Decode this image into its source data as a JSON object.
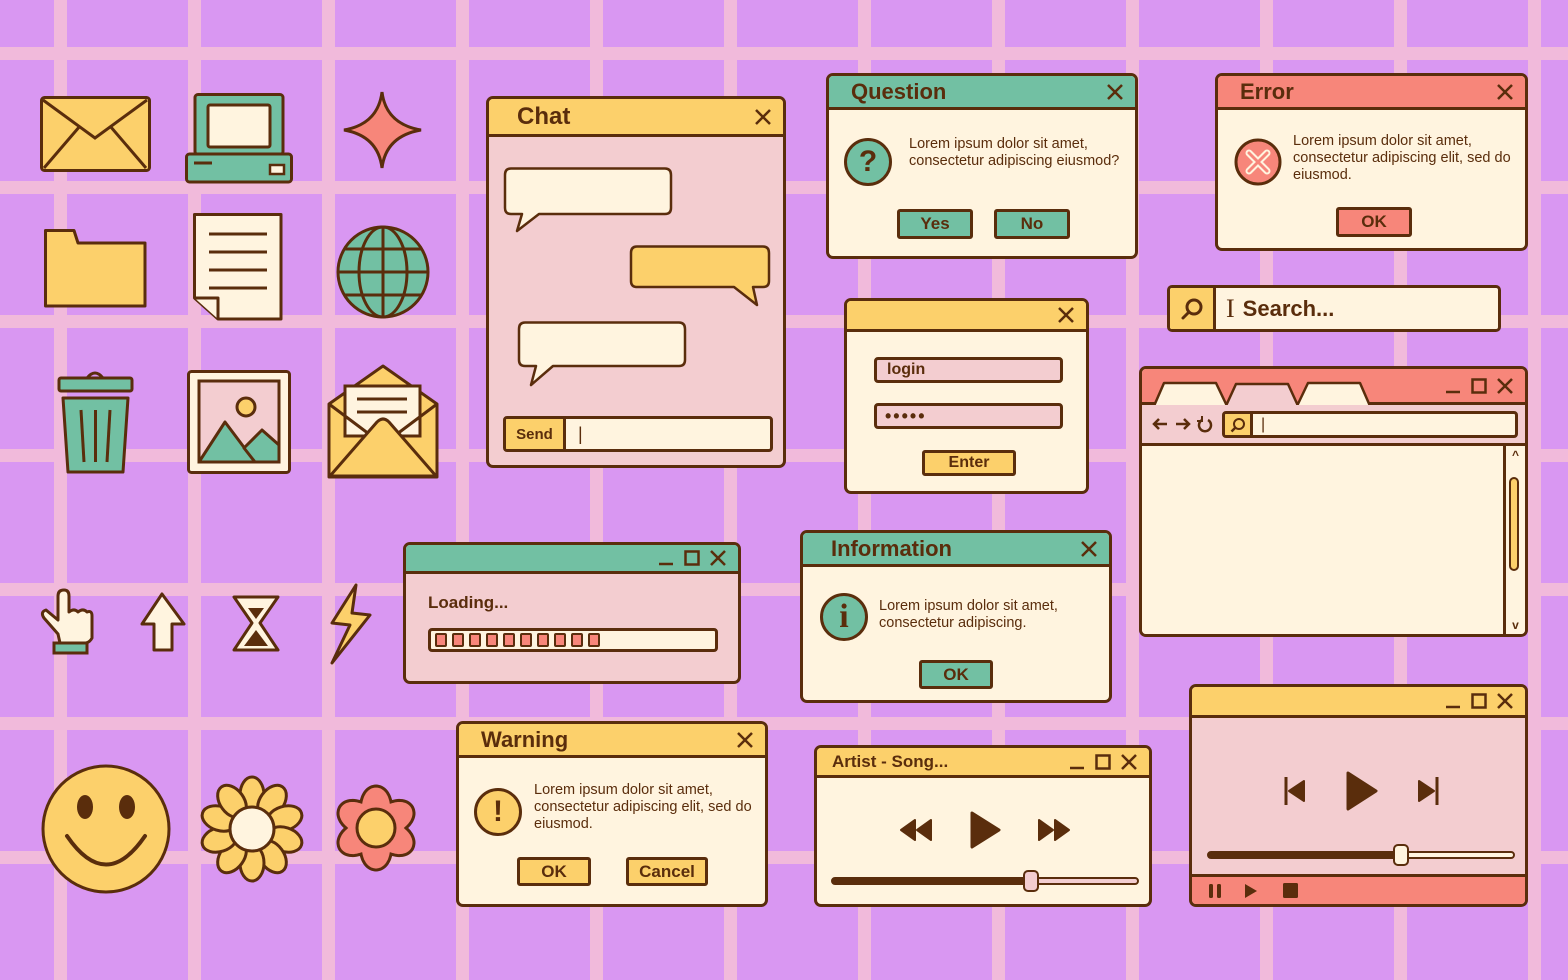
{
  "colors": {
    "background": "#d997f2",
    "grid": "#f1badb",
    "ink": "#5a2d0c",
    "cream": "#fff4df",
    "pink": "#f3cdd0",
    "yellow": "#fcd06b",
    "teal": "#72c0a3",
    "coral": "#f7867a"
  },
  "icons": [
    "envelope-icon",
    "computer-icon",
    "sparkle-icon",
    "folder-icon",
    "document-icon",
    "globe-icon",
    "trash-icon",
    "image-icon",
    "open-envelope-icon",
    "hand-cursor-icon",
    "arrow-cursor-icon",
    "hourglass-icon",
    "lightning-icon",
    "smiley-icon",
    "daisy-icon",
    "flower-icon"
  ],
  "chat": {
    "title": "Chat",
    "send_label": "Send",
    "input_value": "|",
    "messages": [
      {
        "side": "left",
        "color": "cream"
      },
      {
        "side": "right",
        "color": "yellow"
      },
      {
        "side": "left",
        "color": "cream"
      }
    ]
  },
  "question": {
    "title": "Question",
    "message": "Lorem ipsum dolor sit amet, consectetur adipiscing eiusmod?",
    "icon_glyph": "?",
    "yes_label": "Yes",
    "no_label": "No"
  },
  "error": {
    "title": "Error",
    "message": "Lorem ipsum dolor sit amet, consectetur adipiscing elit, sed do eiusmod.",
    "ok_label": "OK"
  },
  "search": {
    "placeholder": "Search...",
    "cursor": "I"
  },
  "login": {
    "login_value": "login",
    "password_value": "•••••",
    "enter_label": "Enter"
  },
  "browser": {
    "tabs": [
      "",
      "",
      ""
    ],
    "active_tab_index": 1,
    "address_value": "|",
    "scroll_up": "^",
    "scroll_down": "v"
  },
  "loading": {
    "label": "Loading...",
    "segments_filled": 10,
    "progress_percent": 60
  },
  "information": {
    "title": "Information",
    "message": "Lorem ipsum dolor sit amet, consectetur adipiscing.",
    "icon_glyph": "i",
    "ok_label": "OK"
  },
  "warning": {
    "title": "Warning",
    "message": "Lorem ipsum dolor sit amet, consectetur adipiscing elit, sed do eiusmod.",
    "icon_glyph": "!",
    "ok_label": "OK",
    "cancel_label": "Cancel"
  },
  "music_player": {
    "title": "Artist - Song...",
    "progress_percent": 65
  },
  "video_player": {
    "progress_percent": 63
  }
}
